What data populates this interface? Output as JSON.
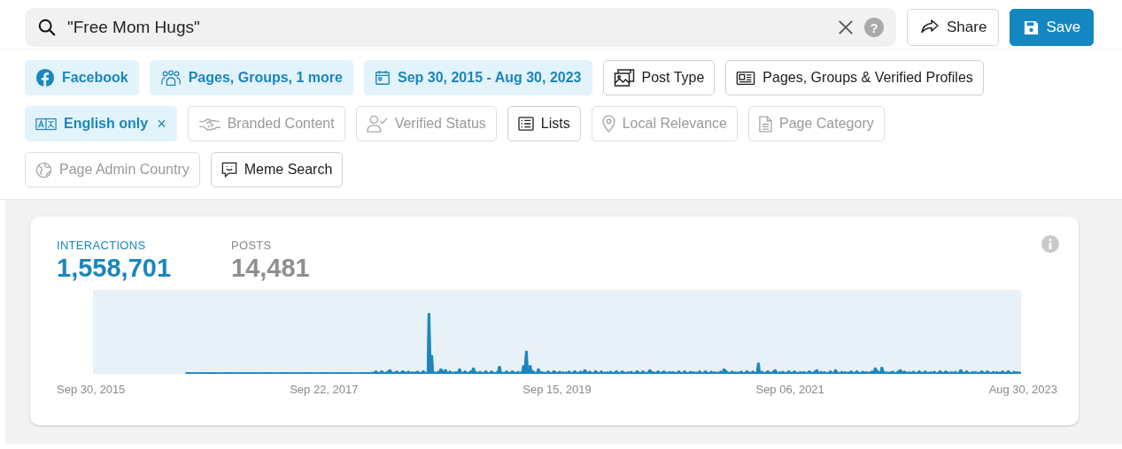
{
  "search": {
    "value": "\"Free Mom Hugs\"",
    "help": "?"
  },
  "actions": [
    {
      "label": "Share",
      "kind": "secondary"
    },
    {
      "label": "Save",
      "kind": "primary"
    }
  ],
  "filters": [
    {
      "label": "Facebook",
      "applied": true,
      "disabled": false
    },
    {
      "label": "Pages, Groups, 1 more",
      "applied": true,
      "disabled": false
    },
    {
      "label": "Sep 30, 2015 - Aug 30, 2023",
      "applied": true,
      "disabled": false
    },
    {
      "label": "Post Type",
      "applied": false,
      "disabled": false
    },
    {
      "label": "Pages, Groups & Verified Profiles",
      "applied": false,
      "disabled": false
    },
    {
      "label": "English only",
      "applied": true,
      "disabled": false,
      "remove": "×"
    },
    {
      "label": "Branded Content",
      "applied": false,
      "disabled": true
    },
    {
      "label": "Verified Status",
      "applied": false,
      "disabled": true
    },
    {
      "label": "Lists",
      "applied": false,
      "disabled": false
    },
    {
      "label": "Local Relevance",
      "applied": false,
      "disabled": true
    },
    {
      "label": "Page Category",
      "applied": false,
      "disabled": true
    },
    {
      "label": "Page Admin Country",
      "applied": false,
      "disabled": true
    },
    {
      "label": "Meme Search",
      "applied": false,
      "disabled": false
    }
  ],
  "stats": {
    "metrics": [
      {
        "label": "INTERACTIONS",
        "value": "1,558,701",
        "selected": true
      },
      {
        "label": "POSTS",
        "value": "14,481",
        "selected": false
      }
    ],
    "x_labels": [
      "Sep 30, 2015",
      "Sep 22, 2017",
      "Sep 15, 2019",
      "Sep 06, 2021",
      "Aug 30, 2023"
    ]
  }
}
